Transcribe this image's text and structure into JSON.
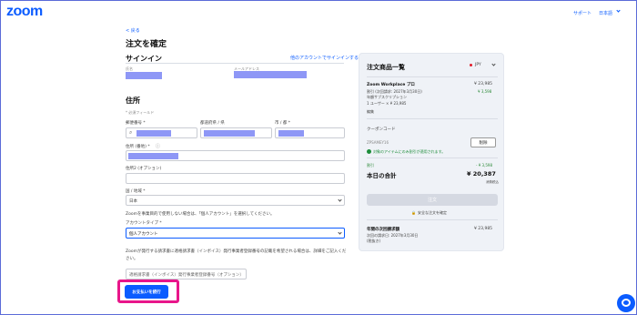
{
  "header": {
    "logo": "zoom",
    "support": "サポート",
    "language": "日本語"
  },
  "page": {
    "back": "< 戻る",
    "title": "注文を確定"
  },
  "signin": {
    "title": "サインイン",
    "other_account": "他のアカウントでサインインする",
    "name_label": "氏名",
    "email_label": "メールアドレス"
  },
  "address": {
    "title": "住所",
    "required_note": "* 必須フィールド",
    "postal_label": "郵便番号 *",
    "prefecture_label": "都道府県 / 県",
    "city_label": "市 / 都 *",
    "address1_label": "住所 (番地) *",
    "address2_label": "住所2 (オプション)",
    "country_label": "国 / 地域 *",
    "country_value": "日本",
    "business_note": "Zoomを事業目的で使用しない場合は、「個人アカウント」を選択してください。",
    "account_type_label": "アカウントタイプ *",
    "account_type_value": "個人アカウント",
    "invoice_note": "Zoomが発行する請求書に適格請求書（インボイス）発行事業者登録番号の記載を希望される場合は、詳細をご記入ください。",
    "invoice_placeholder": "適格請求書（インボイス）発行事業者登録番号（オプション）"
  },
  "actions": {
    "pay_button": "お支払いを続行"
  },
  "summary": {
    "title": "注文商品一覧",
    "currency": "JPY",
    "product_name": "Zoom Workplace プロ",
    "product_price": "¥ 23,985",
    "period_label": "割引 (次回請求: 2027年3月30日)",
    "period_price": "¥ 3,598",
    "billing_type": "年額サブスクリプション",
    "licenses": "1 ユーザー × ¥ 23,985",
    "edit": "編集",
    "coupon_label": "クーポンコード",
    "coupon_code": "ZPSAMEY16",
    "coupon_remove": "削除",
    "coupon_applied": "対象のアイテムにのみ割引が適用されます。",
    "discount_label": "割引",
    "discount_value": "- ¥ 3,598",
    "total_label": "本日の合計",
    "total_value": "¥ 20,387",
    "tax_note": "消費税込",
    "order_button": "注文",
    "secure_note": "安全な注文を確定",
    "next_bill_label": "年間の次回請求額",
    "next_bill_value": "¥ 23,985",
    "next_bill_date": "次回の請求日: 2027年3月30日",
    "next_bill_tax": "(税抜き)"
  }
}
